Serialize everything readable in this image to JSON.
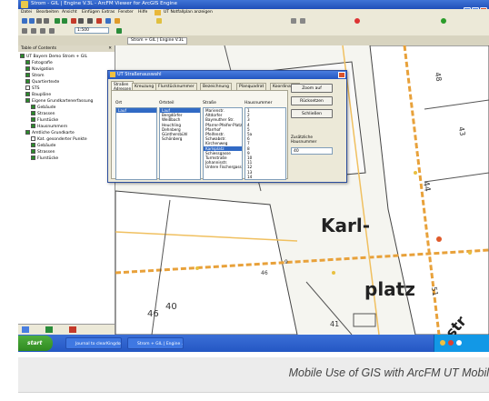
{
  "window": {
    "title": "Strom - GIL | Engine V.3L - ArcFM Viewer for ArcGIS Engine"
  },
  "menu": [
    "Datei",
    "Bearbeiten",
    "Ansicht",
    "Einfügen",
    "Extras",
    "Fenster",
    "Hilfe",
    "UT Notfallplan anzeigen"
  ],
  "toolbar": {
    "scale": "1:500",
    "location_tab": "Strom + GIL | Engine V.3L"
  },
  "toc": {
    "header": "Table of Contents",
    "items": [
      "UT Bayern Demo Strom + GIL",
      "Fotografie",
      "Navigation",
      "Strom",
      "Quartiertexte",
      "STS",
      "Baupläne",
      "Eigene Grundkartenerfassung",
      "Gebäude",
      "Strassen",
      "Flurstücke",
      "Hausnummern",
      "Amtliche Grundkarte",
      "Kat. gesonderter Punkte",
      "Gebäude",
      "Strassen",
      "Flurstücke"
    ]
  },
  "dialog": {
    "title": "UT Straßenauswahl",
    "tabs": [
      "Straßen",
      "Adressen",
      "Kreuzung",
      "Flurstücknummer",
      "Bezeichnung",
      "Planquadrat",
      "Koordinaten"
    ],
    "columns": [
      "Ort",
      "Ortsteil",
      "Straße",
      "Hausnummer"
    ],
    "orte": [
      "Lauf"
    ],
    "ortsteile": [
      "Lauf",
      "Bergdörfer",
      "Weißbach",
      "Heuchling",
      "Dehnberg",
      "Günthersbühl",
      "Schönberg"
    ],
    "strassen": [
      "Marienstr.",
      "Altdorfer",
      "Bayreuther Str.",
      "Pfarrer-Pfeifer-Platz",
      "Pfarrhof",
      "Pfeifenstr.",
      "Schwabstr.",
      "Kirchenweg",
      "Karlsplatz",
      "Schiessgasse",
      "Turmstraße",
      "Johannisstr.",
      "Untere Fischergasse"
    ],
    "hausnummern": [
      "1",
      "2",
      "3",
      "4",
      "5",
      "5a",
      "6",
      "7",
      "8",
      "9",
      "10",
      "11",
      "12",
      "13",
      "14",
      "15",
      "16",
      "17"
    ],
    "buttons": {
      "zoom": "Zoom auf",
      "reset": "Rücksetzen",
      "close": "Schließen"
    },
    "extra_label": "Zusätzliche Hausnummer",
    "extra_value": "40"
  },
  "map": {
    "labels": [
      "Karl-",
      "platz",
      "str"
    ],
    "numbers": [
      "44",
      "40",
      "16",
      "48",
      "41",
      "43",
      "46",
      "51",
      "9",
      "46"
    ]
  },
  "taskbar": {
    "start": "start",
    "tasks": [
      "Journal to clearKingdom",
      "Strom + GIL | Engine ..."
    ]
  },
  "caption": "Mobile Use of GIS with ArcFM UT Mobil"
}
